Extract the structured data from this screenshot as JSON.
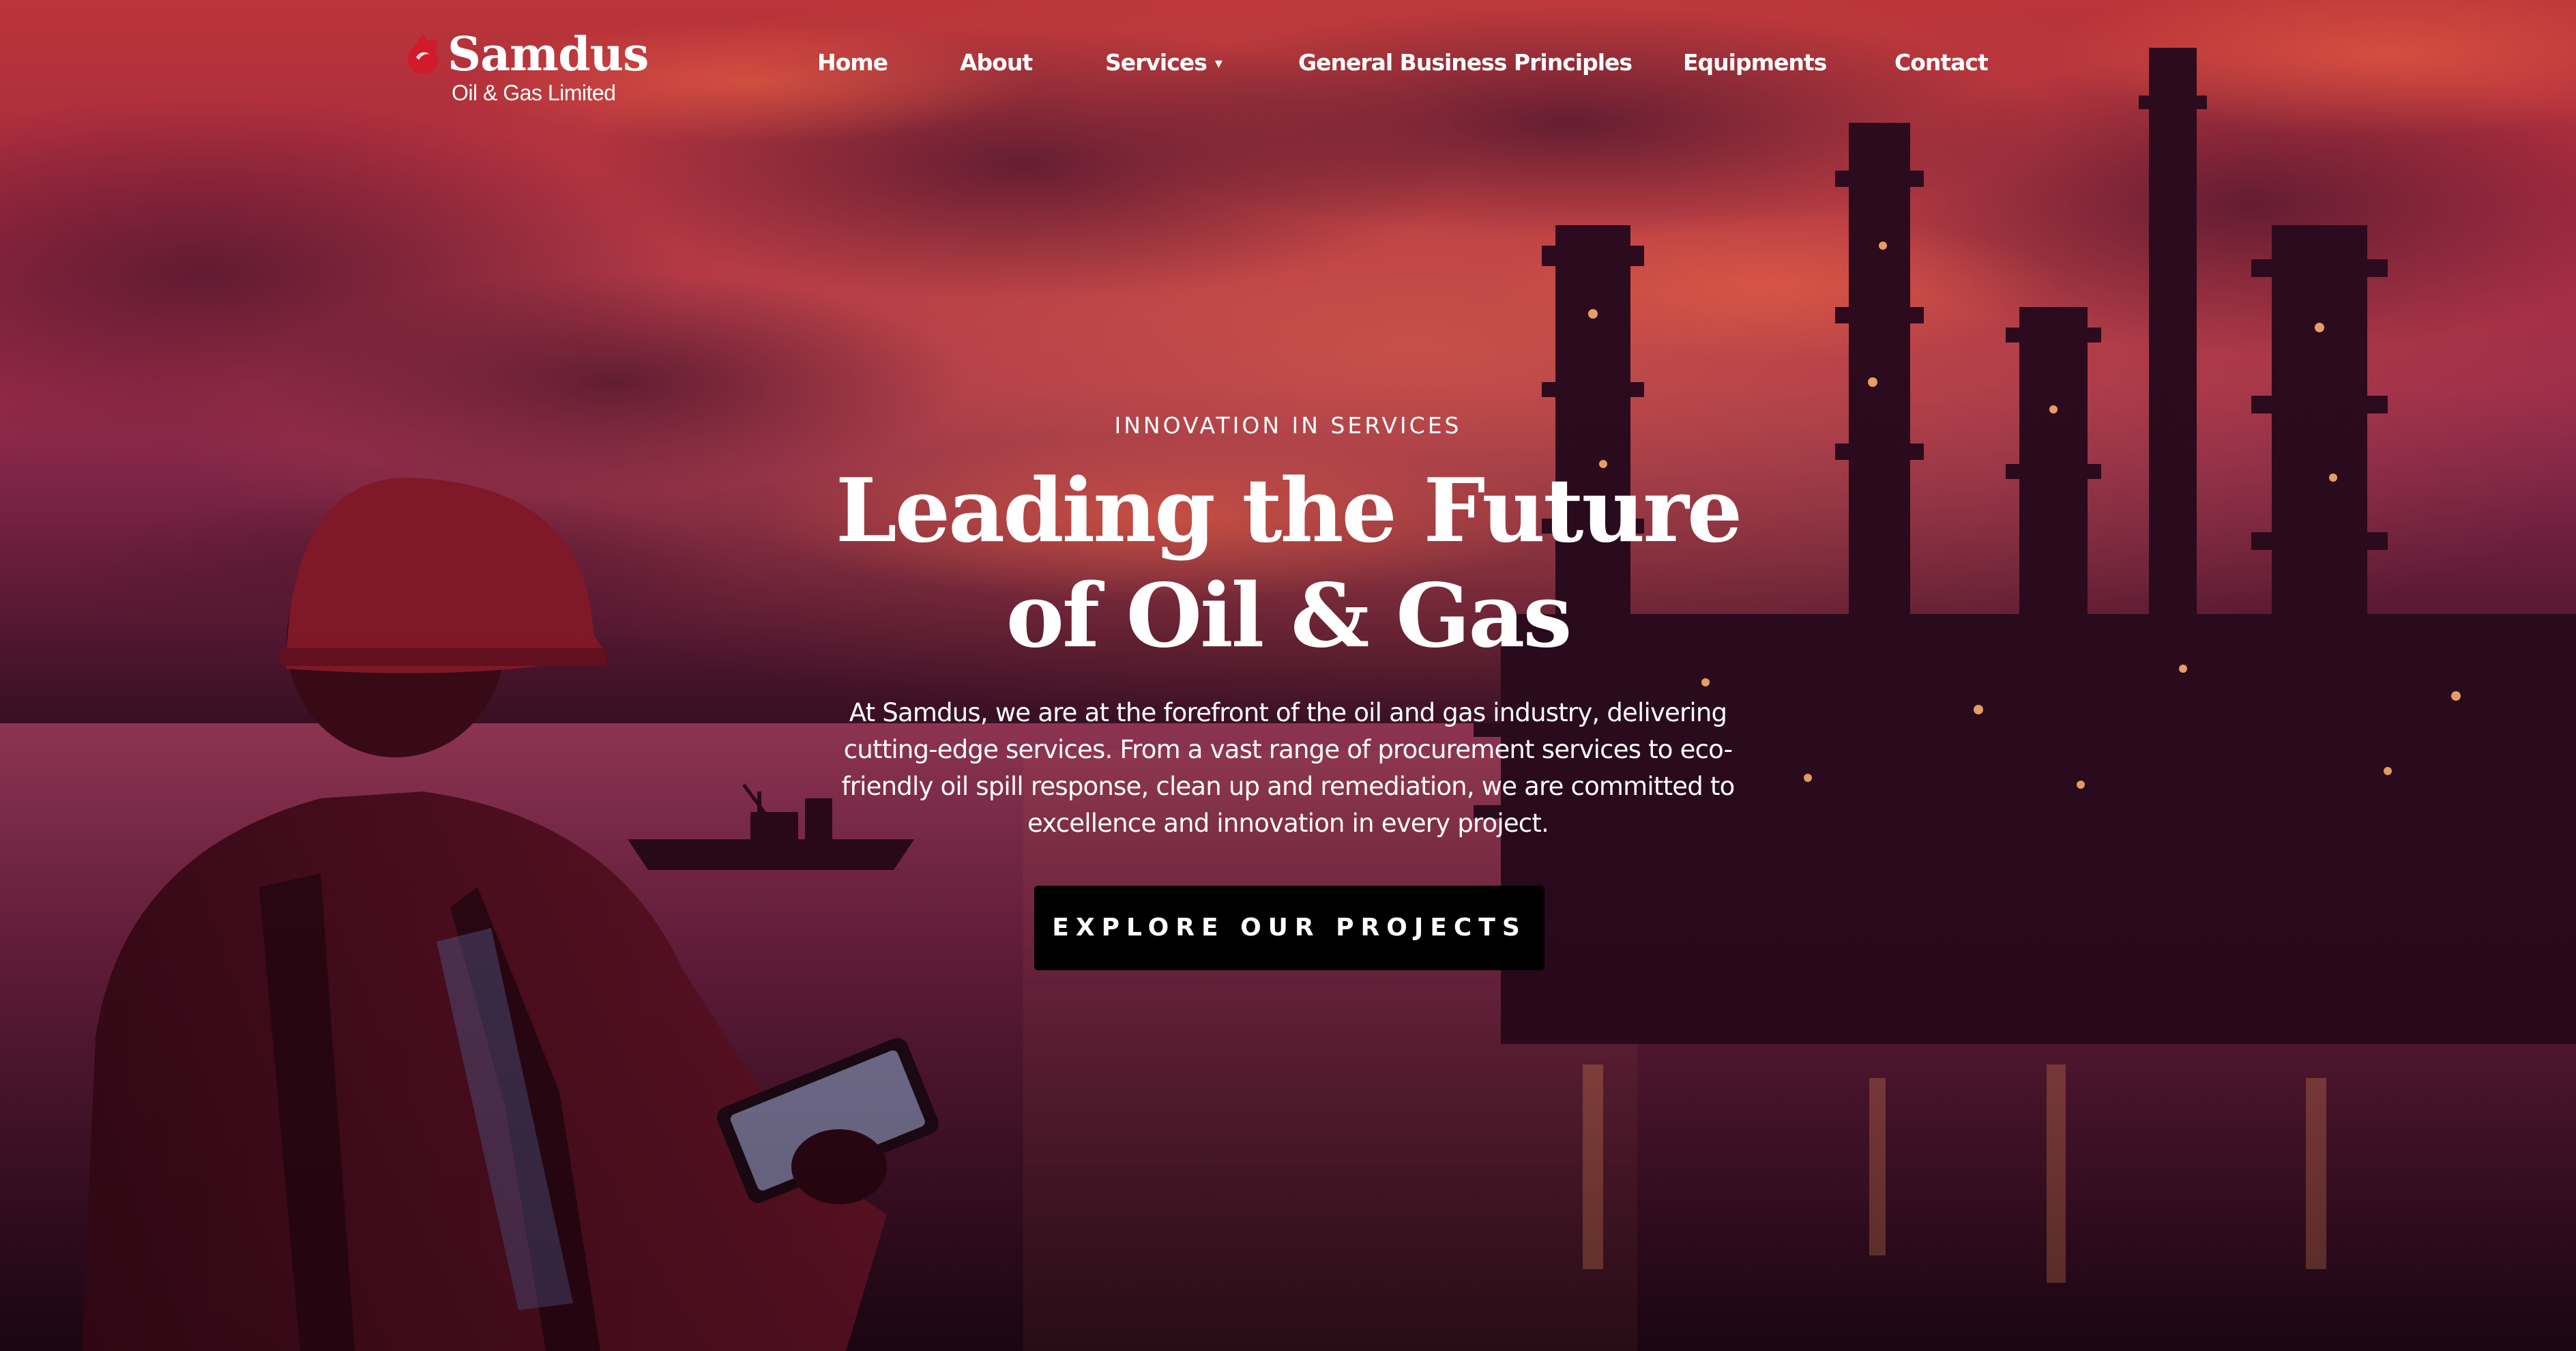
{
  "header": {
    "logo": {
      "name": "Samdus",
      "subtitle": "Oil & Gas Limited",
      "icon": "red-drop-logo-icon"
    },
    "nav": [
      {
        "label": "Home"
      },
      {
        "label": "About"
      },
      {
        "label": "Services",
        "has_dropdown": true,
        "icon": "chevron-down-icon"
      },
      {
        "label": "General Business Principles"
      },
      {
        "label": "Equipments"
      },
      {
        "label": "Contact"
      }
    ]
  },
  "hero": {
    "eyebrow": "INNOVATION IN SERVICES",
    "headline_line1": "Leading the Future",
    "headline_line2": "of Oil & Gas",
    "description": "At Samdus, we are at the forefront of the oil and gas industry, delivering cutting-edge services. From a vast range of procurement services to eco-friendly oil spill response, clean up and remediation, we are committed to excellence and innovation in every project.",
    "cta_label": "EXPLORE OUR PROJECTS"
  },
  "colors": {
    "brand_red": "#d11a2a",
    "cta_bg": "#000000",
    "text": "#ffffff",
    "sky_top": "#c43a4a",
    "sky_bottom": "#7a2040"
  }
}
